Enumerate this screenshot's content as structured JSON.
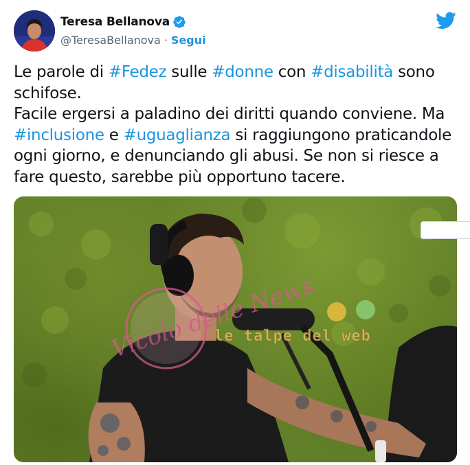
{
  "author": {
    "name": "Teresa Bellanova",
    "handle": "@TeresaBellanova",
    "separator": "·",
    "follow_label": "Segui"
  },
  "icons": {
    "verified": "verified-badge-icon",
    "brand": "twitter-bird-icon"
  },
  "colors": {
    "link": "#1b95e0",
    "text": "#0f1419",
    "secondary": "#536471"
  },
  "tweet": {
    "p1": {
      "t1": "Le parole di ",
      "h1": "#Fedez",
      "t2": " sulle ",
      "h2": "#donne",
      "t3": " con ",
      "h3": "#disabilità",
      "t4": " sono schifose."
    },
    "p2": {
      "t1": "Facile ergersi a paladino dei diritti quando conviene. Ma ",
      "h1": "#inclusione",
      "t2": " e ",
      "h2": "#uguaglianza",
      "t3": " si raggiungono praticandole ogni giorno, e denunciando gli abusi. Se non si riesce a fare questo, sarebbe più opportuno tacere."
    }
  },
  "media": {
    "watermark_left": "Vicolo delle News",
    "watermark_right": "le talpe del web"
  }
}
